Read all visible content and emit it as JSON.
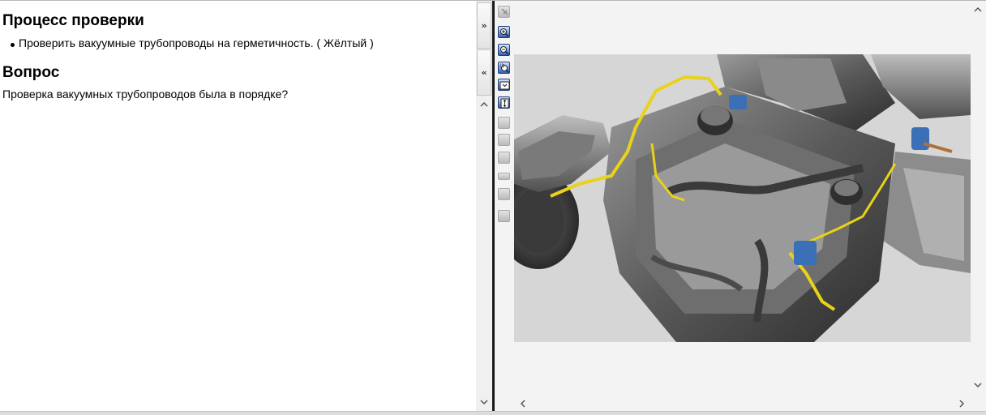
{
  "text_pane": {
    "section1_title": "Процесс проверки",
    "section1_item": "Проверить вакуумные трубопроводы на герметичность. ( Жёлтый )",
    "section2_title": "Вопрос",
    "section2_text": "Проверка вакуумных трубопроводов была в порядке?"
  },
  "splitter": {
    "expand_label": "»",
    "collapse_label": "«"
  },
  "viewer": {
    "toolbar_icons": [
      "select-icon",
      "zoom-in-icon",
      "zoom-out-icon",
      "zoom-area-icon",
      "fit-window-icon",
      "fit-height-icon",
      "disabled-tool-icon",
      "disabled-tool-icon",
      "disabled-tool-icon",
      "disabled-tool-icon",
      "disabled-tool-icon",
      "disabled-tool-icon"
    ],
    "image_alt": "engine-diagram",
    "highlight_color": "#e8d21a",
    "accent_color": "#2d5fb8"
  },
  "scroll": {
    "up": "^",
    "down": "v",
    "left": "<",
    "right": ">"
  }
}
